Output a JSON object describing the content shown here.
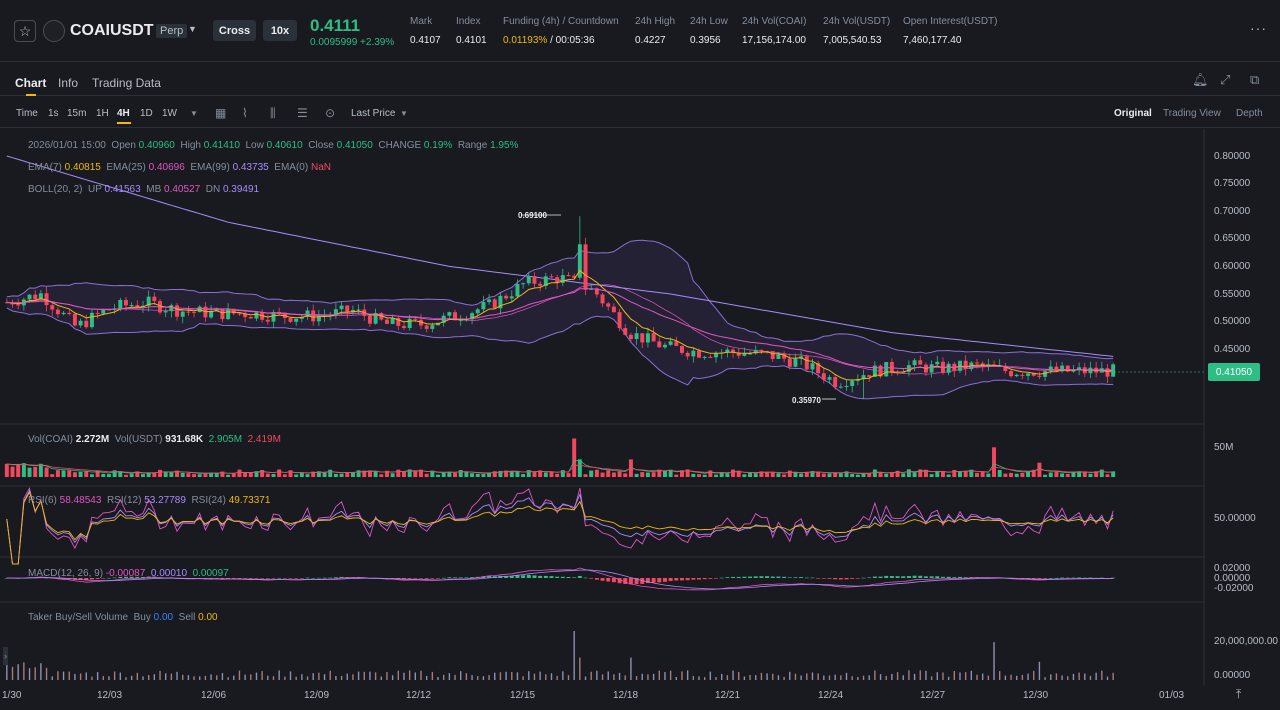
{
  "header": {
    "symbol": "COAIUSDT",
    "contract_type": "Perp",
    "margin_mode": "Cross",
    "leverage": "10x",
    "last_price": "0.4111",
    "price_change": "0.0095999 +2.39%",
    "stats": [
      {
        "label": "Mark",
        "value": "0.4107",
        "x": 410
      },
      {
        "label": "Index",
        "value": "0.4101",
        "x": 456
      },
      {
        "label": "Funding (4h) / Countdown",
        "value_rate": "0.01193%",
        "value_countdown": " / 00:05:36",
        "x": 503
      },
      {
        "label": "24h High",
        "value": "0.4227",
        "x": 635
      },
      {
        "label": "24h Low",
        "value": "0.3956",
        "x": 690
      },
      {
        "label": "24h Vol(COAI)",
        "value": "17,156,174.00",
        "x": 742
      },
      {
        "label": "24h Vol(USDT)",
        "value": "7,005,540.53",
        "x": 823
      },
      {
        "label": "Open Interest(USDT)",
        "value": "7,460,177.40",
        "x": 903
      }
    ]
  },
  "tabs": [
    "Chart",
    "Info",
    "Trading Data"
  ],
  "toolbar": {
    "time_label": "Time",
    "intervals": [
      "1s",
      "15m",
      "1H",
      "4H",
      "1D",
      "1W"
    ],
    "selected_interval": "4H",
    "price_type": "Last Price",
    "views": [
      "Original",
      "Trading View",
      "Depth"
    ],
    "selected_view": "Original"
  },
  "legend": {
    "ohlc": {
      "date": "2026/01/01 15:00",
      "open": "0.40960",
      "high": "0.41410",
      "low": "0.40610",
      "close": "0.41050",
      "change": "0.19%",
      "range": "1.95%"
    },
    "ema": {
      "ema7": "0.40815",
      "ema25": "0.40696",
      "ema99": "0.43735",
      "ema0": "NaN"
    },
    "boll": {
      "label": "BOLL(20, 2)",
      "up": "0.41563",
      "mb": "0.40527",
      "dn": "0.39491"
    },
    "vol": {
      "coai": "2.272M",
      "usdt_label": "Vol(USDT)",
      "usdt": "931.68K",
      "ma1": "2.905M",
      "ma2": "2.419M"
    },
    "rsi": {
      "rsi6": "58.48543",
      "rsi12": "53.27789",
      "rsi24": "49.73371"
    },
    "macd": {
      "label": "MACD(12, 26, 9)",
      "dif": "-0.00087",
      "dea": "0.00010",
      "hist": "0.00097"
    },
    "taker": {
      "label": "Taker Buy/Sell Volume",
      "buy": "0.00",
      "sell": "0.00"
    }
  },
  "price_axis": [
    "0.80000",
    "0.75000",
    "0.70000",
    "0.65000",
    "0.60000",
    "0.55000",
    "0.50000",
    "0.45000"
  ],
  "current_price_tag": "0.41050",
  "vol_axis": "50M",
  "rsi_axis": "50.00000",
  "macd_axis": [
    "0.02000",
    "0.00000",
    "-0.02000"
  ],
  "taker_axis": [
    "20,000,000.00",
    "0.00000"
  ],
  "x_axis": [
    "1/30",
    "12/03",
    "12/06",
    "12/09",
    "12/12",
    "12/15",
    "12/18",
    "12/21",
    "12/24",
    "12/27",
    "12/30",
    "01/03"
  ],
  "annotations": {
    "high": "0.69100",
    "low": "0.35970"
  },
  "colors": {
    "up": "#2ebd85",
    "down": "#f6465d",
    "accent": "#f0b90b",
    "bg": "#181a20"
  },
  "chart_data": {
    "type": "candlestick",
    "interval": "4H",
    "x_range": [
      "11/30",
      "01/01 15:00"
    ],
    "ylim": [
      0.33,
      0.82
    ],
    "series_price_keypoints": [
      {
        "x": "11/30",
        "y": 0.535
      },
      {
        "x": "12/01",
        "y": 0.55
      },
      {
        "x": "12/02",
        "y": 0.49
      },
      {
        "x": "12/03",
        "y": 0.525
      },
      {
        "x": "12/04",
        "y": 0.535
      },
      {
        "x": "12/05",
        "y": 0.52
      },
      {
        "x": "12/06",
        "y": 0.515
      },
      {
        "x": "12/07",
        "y": 0.515
      },
      {
        "x": "12/08",
        "y": 0.51
      },
      {
        "x": "12/09",
        "y": 0.51
      },
      {
        "x": "12/10",
        "y": 0.52
      },
      {
        "x": "12/11",
        "y": 0.495
      },
      {
        "x": "12/12",
        "y": 0.495
      },
      {
        "x": "12/13",
        "y": 0.51
      },
      {
        "x": "12/14",
        "y": 0.53
      },
      {
        "x": "12/15",
        "y": 0.57
      },
      {
        "x": "12/16",
        "y": 0.58
      },
      {
        "x": "12/17",
        "y": 0.555
      },
      {
        "x": "12/18",
        "y": 0.48
      },
      {
        "x": "12/19",
        "y": 0.455
      },
      {
        "x": "12/20",
        "y": 0.445
      },
      {
        "x": "12/21",
        "y": 0.445
      },
      {
        "x": "12/22",
        "y": 0.44
      },
      {
        "x": "12/23",
        "y": 0.425
      },
      {
        "x": "12/24",
        "y": 0.39
      },
      {
        "x": "12/25",
        "y": 0.41
      },
      {
        "x": "12/26",
        "y": 0.42
      },
      {
        "x": "12/27",
        "y": 0.415
      },
      {
        "x": "12/28",
        "y": 0.42
      },
      {
        "x": "12/29",
        "y": 0.41
      },
      {
        "x": "12/30",
        "y": 0.41
      },
      {
        "x": "12/31",
        "y": 0.41
      },
      {
        "x": "01/01",
        "y": 0.4105
      }
    ],
    "ema99_keypoints": [
      {
        "x": "11/30",
        "y": 0.8
      },
      {
        "x": "12/06",
        "y": 0.68
      },
      {
        "x": "12/12",
        "y": 0.6
      },
      {
        "x": "12/18",
        "y": 0.55
      },
      {
        "x": "12/24",
        "y": 0.48
      },
      {
        "x": "01/01",
        "y": 0.437
      }
    ],
    "high_marker": {
      "x": "12/16",
      "y": 0.691
    },
    "low_marker": {
      "x": "12/24",
      "y": 0.3597
    }
  }
}
